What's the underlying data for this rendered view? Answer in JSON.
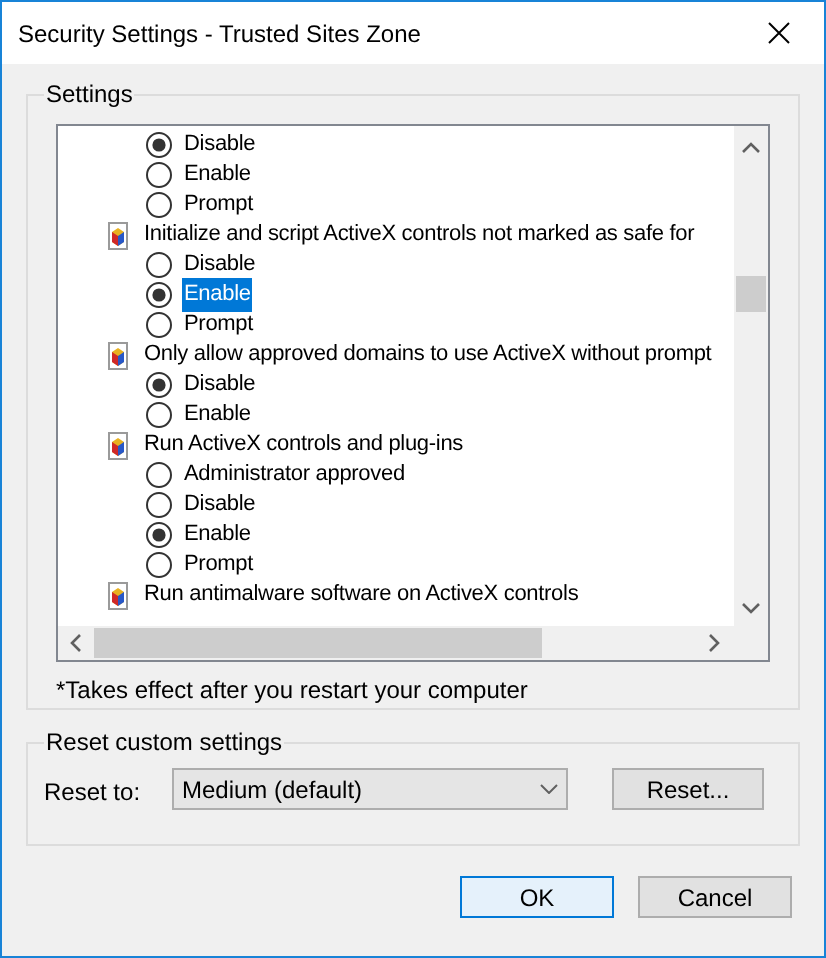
{
  "window": {
    "title": "Security Settings - Trusted Sites Zone"
  },
  "settings": {
    "legend": "Settings",
    "groups": [
      {
        "options": [
          {
            "label": "Disable",
            "selected": true,
            "focused": false
          },
          {
            "label": "Enable",
            "selected": false,
            "focused": false
          },
          {
            "label": "Prompt",
            "selected": false,
            "focused": false
          }
        ]
      },
      {
        "heading": "Initialize and script ActiveX controls not marked as safe for",
        "options": [
          {
            "label": "Disable",
            "selected": false,
            "focused": false
          },
          {
            "label": "Enable",
            "selected": true,
            "focused": true
          },
          {
            "label": "Prompt",
            "selected": false,
            "focused": false
          }
        ]
      },
      {
        "heading": "Only allow approved domains to use ActiveX without prompt",
        "options": [
          {
            "label": "Disable",
            "selected": true,
            "focused": false
          },
          {
            "label": "Enable",
            "selected": false,
            "focused": false
          }
        ]
      },
      {
        "heading": "Run ActiveX controls and plug-ins",
        "options": [
          {
            "label": "Administrator approved",
            "selected": false,
            "focused": false
          },
          {
            "label": "Disable",
            "selected": false,
            "focused": false
          },
          {
            "label": "Enable",
            "selected": true,
            "focused": false
          },
          {
            "label": "Prompt",
            "selected": false,
            "focused": false
          }
        ]
      },
      {
        "heading": "Run antimalware software on ActiveX controls"
      }
    ],
    "note": "*Takes effect after you restart your computer"
  },
  "reset": {
    "legend": "Reset custom settings",
    "label": "Reset to:",
    "dropdown": "Medium (default)",
    "button": "Reset..."
  },
  "buttons": [
    {
      "label": "OK",
      "default": true
    },
    {
      "label": "Cancel",
      "default": false
    }
  ]
}
